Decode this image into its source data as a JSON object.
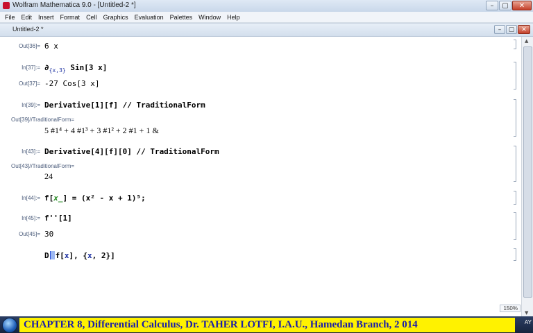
{
  "app": {
    "title": "Wolfram Mathematica 9.0 - [Untitled-2 *]",
    "menu": [
      "File",
      "Edit",
      "Insert",
      "Format",
      "Cell",
      "Graphics",
      "Evaluation",
      "Palettes",
      "Window",
      "Help"
    ]
  },
  "window_buttons": {
    "minimize": "–",
    "maximize": "▢",
    "close": "✕"
  },
  "notebook": {
    "title": "Untitled-2 *",
    "zoom": "150%",
    "cells": {
      "out36": {
        "label": "Out[36]=",
        "content": "6 x"
      },
      "in37": {
        "label": "In[37]:=",
        "op": "∂",
        "sub": "{x,3}",
        "content": "Sin[3 x]"
      },
      "out37": {
        "label": "Out[37]=",
        "content": "-27 Cos[3 x]"
      },
      "in39": {
        "label": "In[39]:=",
        "content": "Derivative[1][f] // TraditionalForm"
      },
      "out39": {
        "label": "Out[39]//TraditionalForm=",
        "content": "5 #1⁴ + 4 #1³ + 3 #1² + 2 #1 + 1 &"
      },
      "in43": {
        "label": "In[43]:=",
        "content": "Derivative[4][f][0] // TraditionalForm"
      },
      "out43": {
        "label": "Out[43]//TraditionalForm=",
        "content": "24"
      },
      "in44": {
        "label": "In[44]:=",
        "head": "f[",
        "arg": "x_",
        "rest": "] = (x² - x + 1)⁵;"
      },
      "in45": {
        "label": "In[45]:=",
        "content": "f''[1]"
      },
      "out45": {
        "label": "Out[45]=",
        "content": "30"
      },
      "input": {
        "pre": "D",
        "post": "f[",
        "var1": "x",
        "mid": "], {",
        "var2": "x",
        "end": ", 2}]"
      }
    }
  },
  "caption": "CHAPTER 8, Differential Calculus,    Dr.   TAHER LOTFI,  I.A.U., Hamedan Branch,      2 014",
  "tray": {
    "text": "AY"
  }
}
